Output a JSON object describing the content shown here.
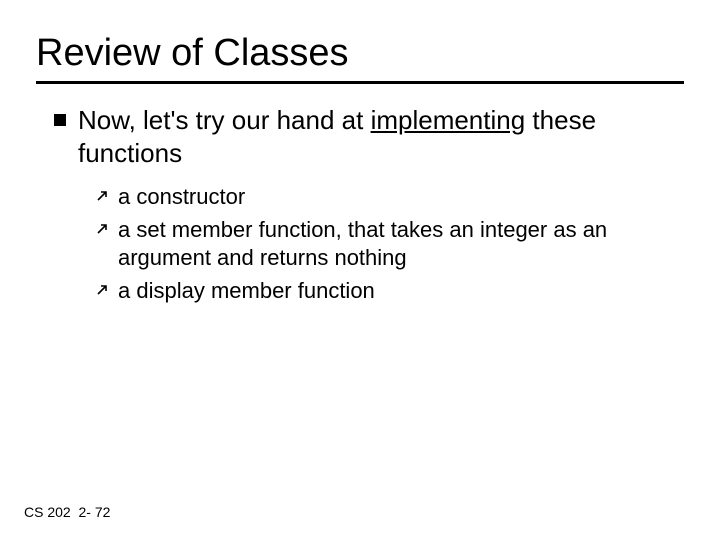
{
  "title": "Review of Classes",
  "main_bullet": {
    "prefix": "Now, let's try our hand at ",
    "underlined": "implementing",
    "suffix": " these functions"
  },
  "sub_bullets": [
    "a constructor",
    "a set member function, that takes an integer as an argument and returns nothing",
    "a display member function"
  ],
  "footer": {
    "course": "CS 202",
    "page": "2- 72"
  }
}
